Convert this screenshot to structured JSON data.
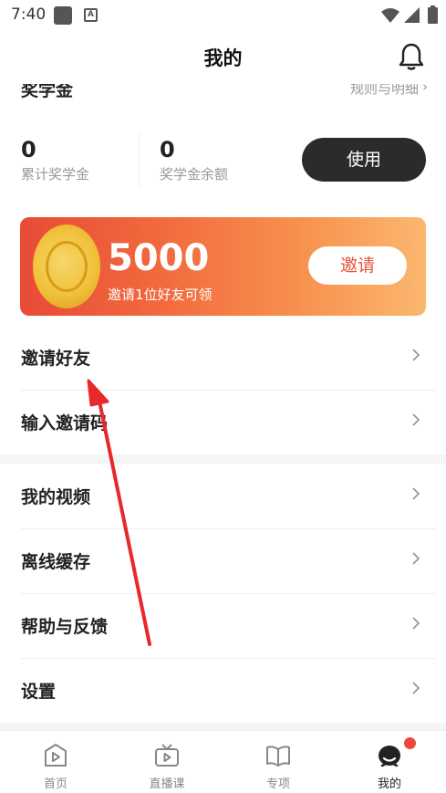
{
  "status_bar": {
    "time": "7:40",
    "icons": [
      "square-notification-icon",
      "a-notification-icon",
      "wifi-icon",
      "signal-icon",
      "battery-icon"
    ]
  },
  "nav": {
    "title": "我的",
    "right_icon": "bell-icon"
  },
  "scholarship": {
    "title": "奖学金",
    "rules_link": "规则与明细",
    "stats": [
      {
        "value": "0",
        "label": "累计奖学金"
      },
      {
        "value": "0",
        "label": "奖学金余额"
      }
    ],
    "use_button": "使用"
  },
  "invite_banner": {
    "amount": "5000",
    "description": "邀请1位好友可领",
    "button": "邀请",
    "icon": "gold-coin-icon"
  },
  "menu_group_1": [
    {
      "label": "邀请好友"
    },
    {
      "label": "输入邀请码"
    }
  ],
  "menu_group_2": [
    {
      "label": "我的视频"
    },
    {
      "label": "离线缓存"
    },
    {
      "label": "帮助与反馈"
    },
    {
      "label": "设置"
    }
  ],
  "tab_bar": [
    {
      "label": "首页",
      "icon": "home-play-icon",
      "active": false
    },
    {
      "label": "直播课",
      "icon": "tv-play-icon",
      "active": false
    },
    {
      "label": "专项",
      "icon": "book-icon",
      "active": false
    },
    {
      "label": "我的",
      "icon": "profile-face-icon",
      "active": true,
      "badge": true
    }
  ],
  "colors": {
    "banner_gradient_start": "#e84b36",
    "banner_gradient_end": "#fbb870",
    "use_button_bg": "#2b2b2b",
    "badge": "#f0473a",
    "annotation_arrow": "#e8282a"
  }
}
